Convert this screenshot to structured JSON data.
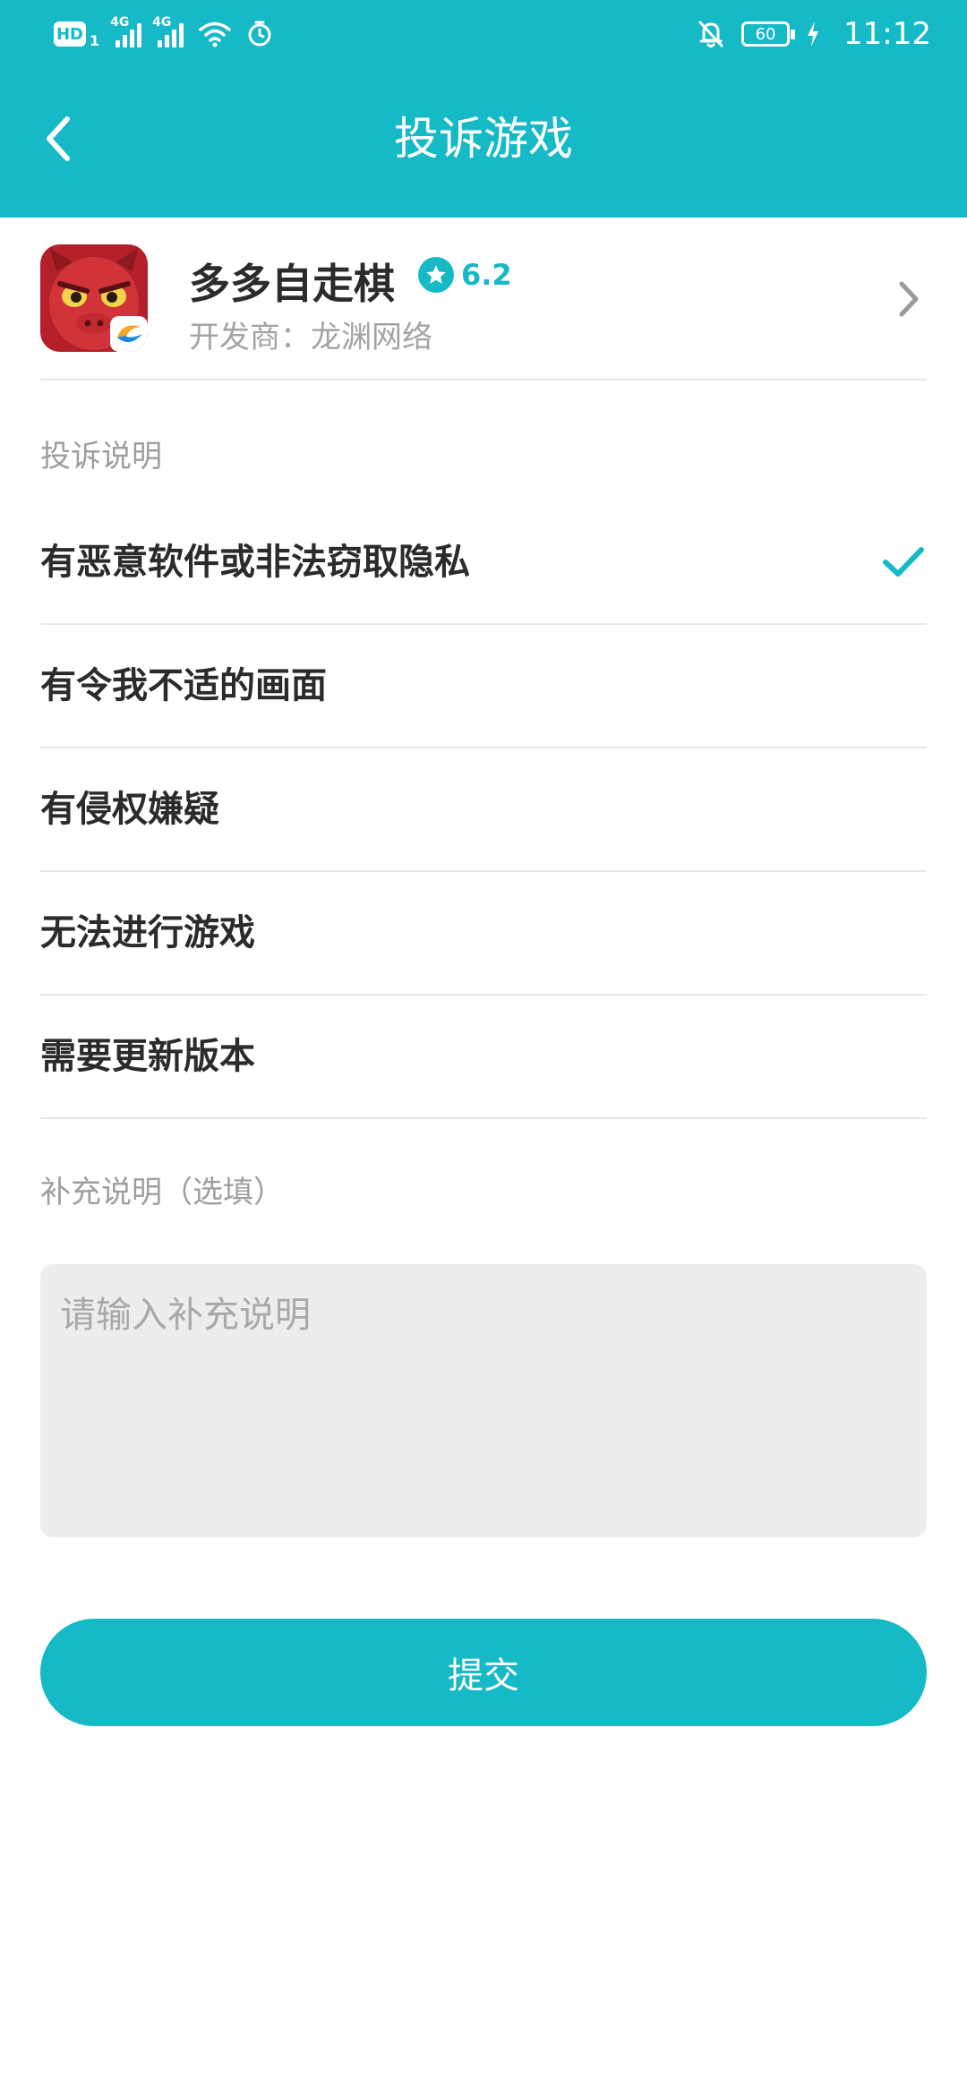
{
  "status_bar": {
    "hd_label": "HD",
    "sim_label": "1",
    "network_1": "4G",
    "network_2": "4G",
    "battery": "60",
    "time": "11:12"
  },
  "header": {
    "title": "投诉游戏",
    "background_color": "#16b9c6"
  },
  "game": {
    "name": "多多自走棋",
    "rating": "6.2",
    "developer_label": "开发商：",
    "developer": "龙渊网络"
  },
  "complaint": {
    "section_label": "投诉说明",
    "options": [
      {
        "label": "有恶意软件或非法窃取隐私",
        "selected": true
      },
      {
        "label": "有令我不适的画面",
        "selected": false
      },
      {
        "label": "有侵权嫌疑",
        "selected": false
      },
      {
        "label": "无法进行游戏",
        "selected": false
      },
      {
        "label": "需要更新版本",
        "selected": false
      }
    ]
  },
  "supplement": {
    "section_label": "补充说明（选填）",
    "placeholder": "请输入补充说明",
    "value": ""
  },
  "submit": {
    "label": "提交"
  },
  "icons": [
    "back-arrow-icon",
    "star-icon",
    "chevron-right-icon",
    "check-icon",
    "mute-bell-icon",
    "wifi-icon",
    "timer-icon",
    "charging-icon"
  ],
  "colors": {
    "accent": "#16b9c6",
    "text": "#2b2b2b",
    "muted": "#9e9e9e",
    "divider": "#e8e8e8",
    "input_bg": "#ededed"
  }
}
